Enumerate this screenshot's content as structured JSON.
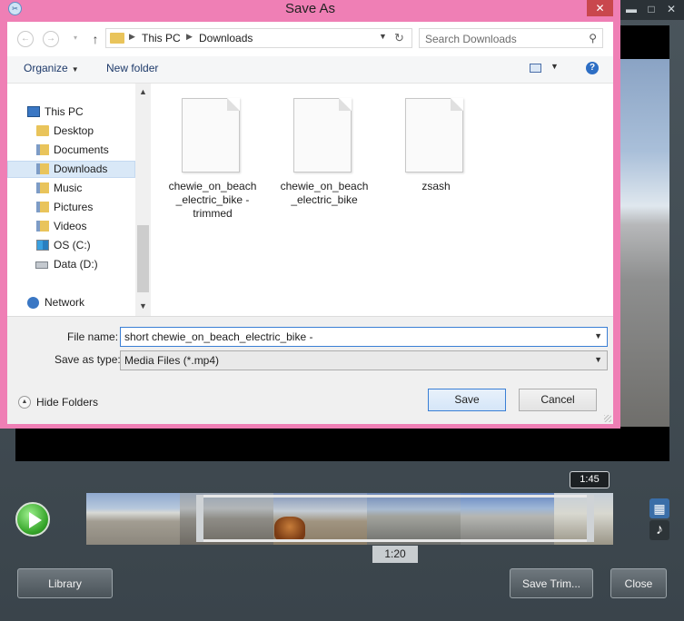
{
  "background_app": {
    "time_top": "1:45",
    "time_bottom": "1:20",
    "buttons": {
      "library": "Library",
      "save_trim": "Save Trim...",
      "close": "Close"
    },
    "media_icons": [
      "film-icon",
      "music-note-icon"
    ]
  },
  "dialog": {
    "title": "Save As",
    "address": {
      "crumbs": [
        "This PC",
        "Downloads"
      ]
    },
    "search": {
      "placeholder": "Search Downloads"
    },
    "toolbar": {
      "organize": "Organize",
      "new_folder": "New folder"
    },
    "nav_tree": [
      {
        "label": "This PC",
        "icon": "computer-icon",
        "selected": false
      },
      {
        "label": "Desktop",
        "icon": "folder-icon",
        "selected": false
      },
      {
        "label": "Documents",
        "icon": "folder-icon",
        "selected": false
      },
      {
        "label": "Downloads",
        "icon": "folder-icon",
        "selected": true
      },
      {
        "label": "Music",
        "icon": "folder-icon",
        "selected": false
      },
      {
        "label": "Pictures",
        "icon": "folder-icon",
        "selected": false
      },
      {
        "label": "Videos",
        "icon": "folder-icon",
        "selected": false
      },
      {
        "label": "OS (C:)",
        "icon": "drive-icon",
        "selected": false
      },
      {
        "label": "Data (D:)",
        "icon": "drive-icon",
        "selected": false
      },
      {
        "label": "Network",
        "icon": "network-icon",
        "selected": false
      }
    ],
    "files": [
      {
        "name": "chewie_on_beach _electric_bike - trimmed"
      },
      {
        "name": "chewie_on_beach _electric_bike"
      },
      {
        "name": "zsash"
      }
    ],
    "form": {
      "file_name_label": "File name:",
      "file_name_value": "short chewie_on_beach_electric_bike -",
      "save_type_label": "Save as type:",
      "save_type_value": "Media Files (*.mp4)"
    },
    "hide_folders": "Hide Folders",
    "save": "Save",
    "cancel": "Cancel"
  },
  "colors": {
    "titlebar": "#ef7fb5",
    "close_button": "#c9474d",
    "accent": "#3a7fd5"
  }
}
